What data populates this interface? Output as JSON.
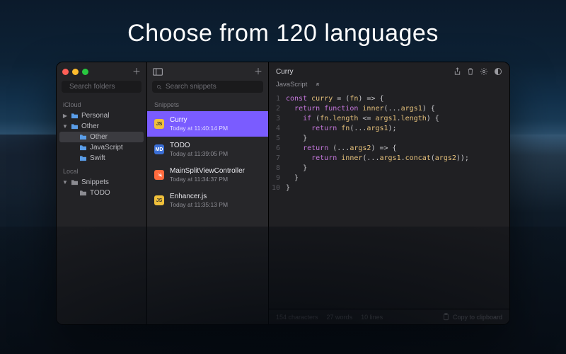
{
  "headline": "Choose from 120 languages",
  "sidebar": {
    "search_placeholder": "Search folders",
    "sections": {
      "icloud_label": "iCloud",
      "local_label": "Local"
    },
    "icloud": {
      "personal": "Personal",
      "other": "Other",
      "other_children": {
        "other": "Other",
        "javascript": "JavaScript",
        "swift": "Swift"
      }
    },
    "local": {
      "snippets": "Snippets",
      "todo": "TODO"
    }
  },
  "list": {
    "search_placeholder": "Search snippets",
    "header": "Snippets",
    "items": [
      {
        "title": "Curry",
        "time": "Today at 11:40:14 PM",
        "icon": "js"
      },
      {
        "title": "TODO",
        "time": "Today at 11:39:05 PM",
        "icon": "md"
      },
      {
        "title": "MainSplitViewController",
        "time": "Today at 11:34:37 PM",
        "icon": "sw"
      },
      {
        "title": "Enhancer.js",
        "time": "Today at 11:35:13 PM",
        "icon": "js"
      }
    ]
  },
  "editor": {
    "title": "Curry",
    "language": "JavaScript",
    "code_lines": [
      "const curry = (fn) => {",
      "  return function inner(...args1) {",
      "    if (fn.length <= args1.length) {",
      "      return fn(...args1);",
      "    }",
      "    return (...args2) => {",
      "      return inner(...args1.concat(args2));",
      "    }",
      "  }",
      "}"
    ],
    "status": {
      "chars": "154 characters",
      "words": "27 words",
      "lines": "10 lines",
      "copy": "Copy to clipboard"
    }
  }
}
